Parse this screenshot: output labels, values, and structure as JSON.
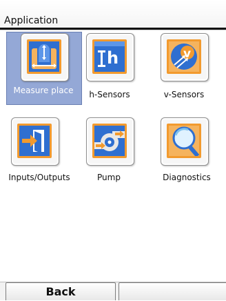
{
  "header": {
    "title": "Application"
  },
  "tiles": [
    {
      "label": "Measure place",
      "icon": "measure-place-icon",
      "selected": true
    },
    {
      "label": "h-Sensors",
      "icon": "h-sensor-icon",
      "selected": false
    },
    {
      "label": "v-Sensors",
      "icon": "v-sensor-icon",
      "selected": false
    },
    {
      "label": "Inputs/Outputs",
      "icon": "inputs-outputs-icon",
      "selected": false
    },
    {
      "label": "Pump",
      "icon": "pump-icon",
      "selected": false
    },
    {
      "label": "Diagnostics",
      "icon": "diagnostics-icon",
      "selected": false
    }
  ],
  "softkeys": {
    "back": "Back",
    "right": ""
  },
  "colors": {
    "accent_blue": "#2f6fd0",
    "icon_border": "#f29a2e",
    "selection": "#94a8d6"
  }
}
